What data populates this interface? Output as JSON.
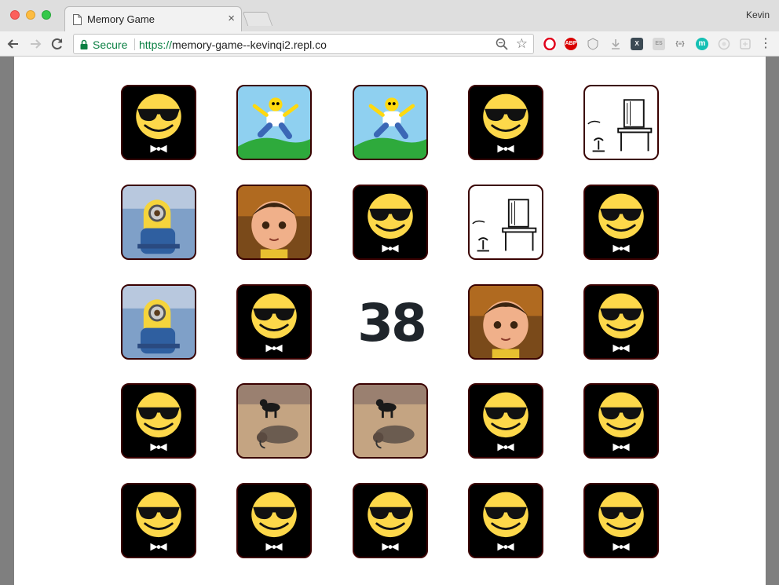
{
  "window": {
    "tab_title": "Memory Game",
    "profile_name": "Kevin"
  },
  "toolbar": {
    "secure_label": "Secure",
    "url_scheme": "https://",
    "url_host": "memory-game--kevinqi2.repl.co",
    "extensions": [
      "opera-icon",
      "abp-icon",
      "shield-icon",
      "download-icon",
      "x-icon",
      "es-icon",
      "json-icon",
      "m-icon",
      "circle-icon",
      "puzzle-icon"
    ],
    "extension_labels": {
      "abp": "ABP",
      "x": "X",
      "es": "ES",
      "json": "{≡}",
      "m": "m"
    }
  },
  "game": {
    "score": "38",
    "cards": [
      [
        "emoji",
        "homer",
        "homer",
        "emoji",
        "computer"
      ],
      [
        "minion",
        "agnes",
        "emoji",
        "computer",
        "emoji"
      ],
      [
        "minion",
        "emoji",
        null,
        "agnes",
        "emoji"
      ],
      [
        "emoji",
        "cat",
        "cat",
        "emoji",
        "emoji"
      ],
      [
        "emoji",
        "emoji",
        "emoji",
        "emoji",
        "emoji"
      ]
    ]
  },
  "colors": {
    "card_back": "#000000",
    "emoji_face": "#fdd84a",
    "score_text": "#1f252b",
    "secure_green": "#0b8043"
  }
}
